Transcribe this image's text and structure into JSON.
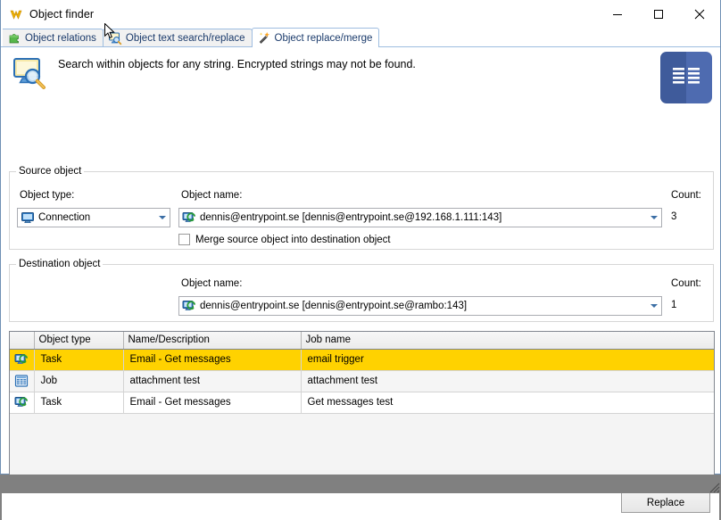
{
  "window": {
    "title": "Object finder",
    "app_icon": "v-logo-icon",
    "controls": {
      "minimize": "minimize-icon",
      "maximize": "maximize-icon",
      "close": "close-icon"
    }
  },
  "tabs": [
    {
      "label": "Object relations",
      "icon": "puzzle-piece-icon",
      "active": false
    },
    {
      "label": "Object text search/replace",
      "icon": "monitor-search-icon",
      "active": false
    },
    {
      "label": "Object replace/merge",
      "icon": "magic-wand-icon",
      "active": true
    }
  ],
  "banner": {
    "icon": "monitor-magnifier-icon",
    "text": "Search within objects for any string. Encrypted strings may not be found.",
    "logo": "book-list-logo-icon",
    "logo_color": "#3f5b9b"
  },
  "source": {
    "legend": "Source object",
    "object_type_label": "Object type:",
    "object_type_value": "Connection",
    "object_type_icon": "monitor-icon",
    "object_name_label": "Object name:",
    "object_name_value": "dennis@entrypoint.se [dennis@entrypoint.se@192.168.1.111:143]",
    "object_name_icon": "connection-refresh-icon",
    "merge_checkbox_label": "Merge source object into destination object",
    "merge_checked": false,
    "count_label": "Count:",
    "count_value": "3"
  },
  "destination": {
    "legend": "Destination object",
    "object_name_label": "Object name:",
    "object_name_value": "dennis@entrypoint.se [dennis@entrypoint.se@rambo:143]",
    "object_name_icon": "connection-refresh-icon",
    "count_label": "Count:",
    "count_value": "1"
  },
  "grid": {
    "columns": [
      "",
      "Object type",
      "Name/Description",
      "Job name"
    ],
    "rows": [
      {
        "icon": "task-refresh-icon",
        "object_type": "Task",
        "name_description": "Email - Get messages",
        "job_name": "email trigger",
        "selected": true
      },
      {
        "icon": "job-grid-icon",
        "object_type": "Job",
        "name_description": "attachment test",
        "job_name": "attachment test",
        "selected": false
      },
      {
        "icon": "task-refresh-icon",
        "object_type": "Task",
        "name_description": "Email - Get messages",
        "job_name": "Get messages test",
        "selected": false
      }
    ],
    "selection_color": "#ffd200"
  },
  "footer": {
    "replace_label": "Replace"
  }
}
